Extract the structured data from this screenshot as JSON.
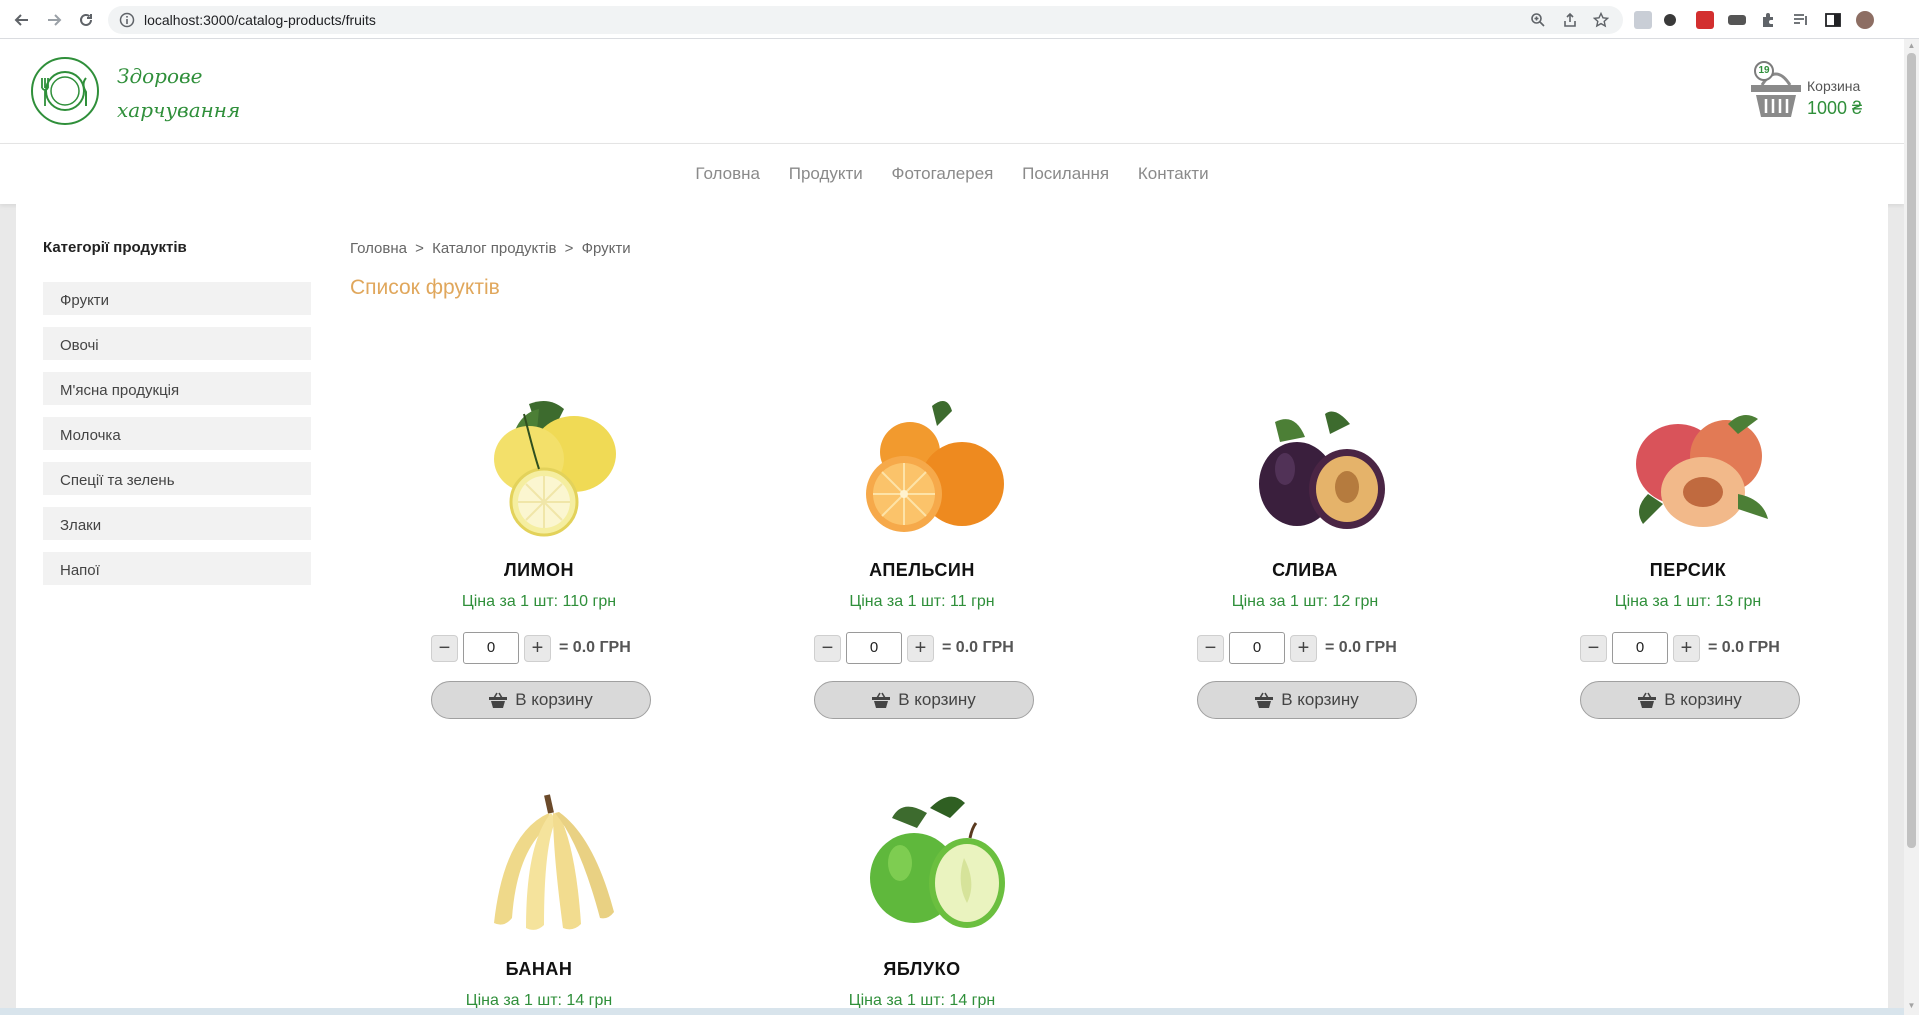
{
  "browser": {
    "url": "localhost:3000/catalog-products/fruits"
  },
  "header": {
    "logo_line1": "Здорове",
    "logo_line2": "харчування",
    "cart_count": "19",
    "cart_label": "Корзина",
    "cart_total": "1000 ₴"
  },
  "nav": {
    "items": [
      "Головна",
      "Продукти",
      "Фотогалерея",
      "Посилання",
      "Контакти"
    ]
  },
  "sidebar": {
    "title": "Категорії продуктів",
    "items": [
      "Фрукти",
      "Овочі",
      "М'ясна продукція",
      "Молочка",
      "Спеції та зелень",
      "Злаки",
      "Напої"
    ]
  },
  "breadcrumb": {
    "home": "Головна",
    "sep1": ">",
    "catalog": "Каталог продуктів",
    "sep2": ">",
    "current": "Фрукти"
  },
  "page_title": "Список фруктів",
  "products": [
    {
      "name": "ЛИМОН",
      "price": "Ціна за 1 шт:  110 грн",
      "qty": "0",
      "total": "= 0.0 ГРН",
      "button": "В корзину",
      "image_icon": "lemon-image"
    },
    {
      "name": "АПЕЛЬСИН",
      "price": "Ціна за 1 шт:  11 грн",
      "qty": "0",
      "total": "= 0.0 ГРН",
      "button": "В корзину",
      "image_icon": "orange-image"
    },
    {
      "name": "СЛИВА",
      "price": "Ціна за 1 шт:  12 грн",
      "qty": "0",
      "total": "= 0.0 ГРН",
      "button": "В корзину",
      "image_icon": "plum-image"
    },
    {
      "name": "ПЕРСИК",
      "price": "Ціна за 1 шт:  13 грн",
      "qty": "0",
      "total": "= 0.0 ГРН",
      "button": "В корзину",
      "image_icon": "peach-image"
    },
    {
      "name": "БАНАН",
      "price": "Ціна за 1 шт:  14 грн",
      "qty": "",
      "total": "",
      "button": "",
      "image_icon": "banana-image"
    },
    {
      "name": "ЯБЛУКО",
      "price": "Ціна за 1 шт:  14 грн",
      "qty": "",
      "total": "",
      "button": "",
      "image_icon": "apple-image"
    }
  ],
  "colors": {
    "brand_green": "#2f8f3a",
    "title_orange": "#e0a75c",
    "button_gray": "#d9d9d9"
  }
}
